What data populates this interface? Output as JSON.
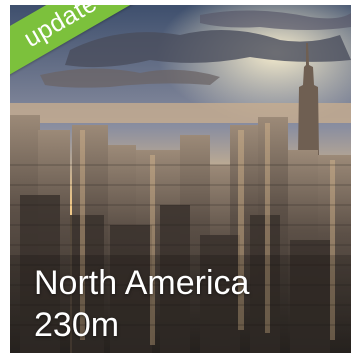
{
  "tile": {
    "region": "North America",
    "count": "230m",
    "badge": "update"
  },
  "colors": {
    "badge": "#7cc13c",
    "caption": "#ffffff"
  }
}
